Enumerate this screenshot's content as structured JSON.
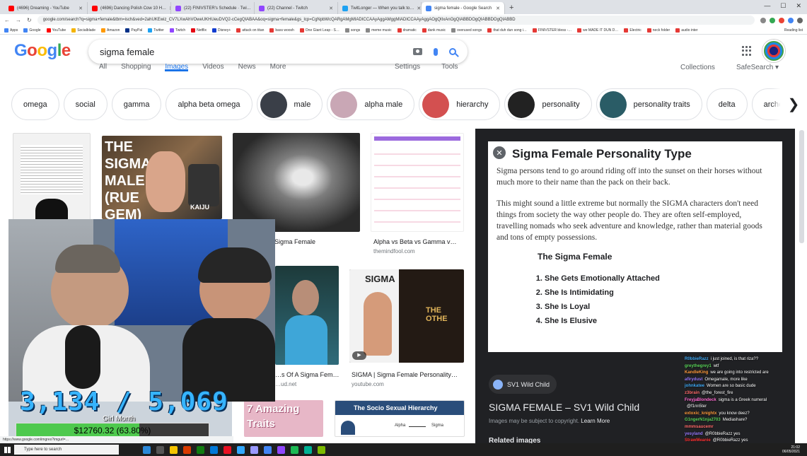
{
  "browser": {
    "tabs": [
      {
        "title": "(4696) Dreaming - YouTube",
        "color": "#ff0000"
      },
      {
        "title": "(4696) Dancing Polish Cow 10 H…",
        "color": "#ff0000"
      },
      {
        "title": "(22) FINIVSTER's Schedule · Twi…",
        "color": "#9146ff"
      },
      {
        "title": "(22) Channel - Twitch",
        "color": "#9146ff"
      },
      {
        "title": "TwitLonger — When you talk to…",
        "color": "#1da1f2"
      },
      {
        "title": "sigma female - Google Search",
        "color": "#4285f4"
      }
    ],
    "url": "google.com/search?q=sigma+female&tbm=isch&ved=2ahUKEwiz_CV7LXwAhVOweUKHUeuDVQ2-cCegQIABAA&oq=sigma+female&gs_lcp=CgNpbWcQARgAMgMIADICCAAyAggAMggMIADICCAAyAggAOgQIIxAnOgQIABBDOgQIABBDOgQIABBD",
    "bookmarks": [
      {
        "label": "Apps",
        "color": "#4285f4"
      },
      {
        "label": "Google",
        "color": "#4285f4"
      },
      {
        "label": "YouTube",
        "color": "#ff0000"
      },
      {
        "label": "Socialblade",
        "color": "#f4b400"
      },
      {
        "label": "Amazon",
        "color": "#ff9900"
      },
      {
        "label": "PayPal",
        "color": "#003087"
      },
      {
        "label": "Twitter",
        "color": "#1da1f2"
      },
      {
        "label": "Twitch",
        "color": "#9146ff"
      },
      {
        "label": "Netflix",
        "color": "#e50914"
      },
      {
        "label": "Disney+",
        "color": "#113ccf"
      },
      {
        "label": "attack on titan",
        "color": "#e53935"
      },
      {
        "label": "bass woosh",
        "color": "#e53935"
      },
      {
        "label": "One Giant Leap - S…",
        "color": "#e53935"
      },
      {
        "label": "songs",
        "color": "#888888"
      },
      {
        "label": "meme music",
        "color": "#888888"
      },
      {
        "label": "dramatic",
        "color": "#e53935"
      },
      {
        "label": "dank music",
        "color": "#e53935"
      },
      {
        "label": "overused songs",
        "color": "#888888"
      },
      {
        "label": "that duh dun song i…",
        "color": "#e53935"
      },
      {
        "label": "FINIVSTER bless -…",
        "color": "#e53935"
      },
      {
        "label": "we MADE IT DUN D…",
        "color": "#e53935"
      },
      {
        "label": "Electric",
        "color": "#e53935"
      },
      {
        "label": "neck folder",
        "color": "#e53935"
      },
      {
        "label": "audio inter",
        "color": "#e53935"
      }
    ],
    "reading_list": "Reading list"
  },
  "google": {
    "logo": [
      "G",
      "o",
      "o",
      "g",
      "l",
      "e"
    ],
    "query": "sigma female",
    "nav": [
      "All",
      "Shopping",
      "Images",
      "Videos",
      "News",
      "More"
    ],
    "nav_active": "Images",
    "nav_right": [
      "Settings",
      "Tools"
    ],
    "collections": "Collections",
    "safesearch": "SafeSearch ▾",
    "chips": [
      {
        "label": "omega",
        "thumb": null
      },
      {
        "label": "social",
        "thumb": null
      },
      {
        "label": "gamma",
        "thumb": null
      },
      {
        "label": "alpha beta omega",
        "thumb": null
      },
      {
        "label": "male",
        "thumb": "#3a3f48"
      },
      {
        "label": "alpha male",
        "thumb": "#c9a7b5"
      },
      {
        "label": "hierarchy",
        "thumb": "#d35050"
      },
      {
        "label": "personality",
        "thumb": "#222222"
      },
      {
        "label": "personality traits",
        "thumb": "#2a5c66"
      },
      {
        "label": "delta",
        "thumb": null
      },
      {
        "label": "archetyp",
        "thumb": null
      }
    ]
  },
  "results": [
    {
      "caption": "Sigma Female",
      "source": ""
    },
    {
      "caption": "Alpha vs Beta vs Gamma v…",
      "source": "themindfool.com"
    },
    {
      "caption": "…s Of A Sigma Fem…",
      "source": "…ud.net"
    },
    {
      "caption": "SIGMA | Sigma Female Personality…",
      "source": "youtube.com"
    }
  ],
  "thumb_text": {
    "sigma_gem": "THE SIGMA MALE (RUE GEM)",
    "kaiju": "KAIJU",
    "sigma_card": "SIGMA",
    "the_other": "THE OTHE",
    "amazing": "7 Amazing Traits",
    "hierarchy": "The Socio Sexual Hierarchy",
    "alpha": "Alpha",
    "sigma_small": "Sigma"
  },
  "preview": {
    "doc_title": "Sigma Female Personality Type",
    "para1": "Sigma persons tend to go around riding off into the sunset on their horses without much more to their name than the pack on their back.",
    "para2": "This might sound a little extreme but normally the SIGMA characters don't need things from society the way other people do. They are often self-employed, travelling nomads who seek adventure and knowledge, rather than material goods and tons of empty possessions.",
    "subheading": "The Sigma Female",
    "list": [
      "She Gets Emotionally Attached",
      "She Is Intimidating",
      "She Is Loyal",
      "She Is Elusive"
    ],
    "source_name": "SV1 Wild Child",
    "title": "SIGMA FEMALE – SV1 Wild Child",
    "copyright": "Images may be subject to copyright.",
    "learn_more": "Learn More",
    "related": "Related images"
  },
  "overlay": {
    "counter": "3,134 / 5,069",
    "girl_month": "Girl Month",
    "money": "$12760.32 (63.80%)",
    "money_pct": 63.8
  },
  "chat": [
    {
      "user": "R0bbieRazz",
      "msg": "i just joined, is that riza??",
      "color": "#3fa9f5"
    },
    {
      "user": "greythegrey1",
      "msg": "wtf",
      "color": "#5cd65c"
    },
    {
      "user": "KandleKing",
      "msg": "we are going into restricted are",
      "color": "#ff9b3d"
    },
    {
      "user": "afirydust",
      "msg": "Omegamale, more like",
      "color": "#9a7cff"
    },
    {
      "user": "johnkatee",
      "msg": "Women are so basic dude",
      "color": "#3fa9f5"
    },
    {
      "user": "z3brain",
      "msg": "@the_forest_fire",
      "color": "#ff6b6b"
    },
    {
      "user": "FreyjaBlondeck",
      "msg": "sigma is a Greek numeral",
      "color": "#ff6bd2"
    },
    {
      "user": "",
      "msg": "@f1nn5ter",
      "color": "#ffffff"
    },
    {
      "user": "extoxic_knightx",
      "msg": "you know deez?",
      "color": "#ff9b3d"
    },
    {
      "user": "G1ngerN1nja2703",
      "msg": "Mediashare?",
      "color": "#5cd65c"
    },
    {
      "user": "mmmsaucemr",
      "msg": "",
      "color": "#ff6b6b"
    },
    {
      "user": "yesyland",
      "msg": "@R0bbieRazz yes",
      "color": "#9a7cff"
    },
    {
      "user": "StrawMeanie",
      "msg": "@R0bbieRazz yes",
      "color": "#ff3333"
    }
  ],
  "statusbar_url": "https://www.google.com/imgres?imgurl=…",
  "taskbar": {
    "search_placeholder": "Type here to search",
    "time": "21:02",
    "date": "06/05/2021",
    "icon_colors": [
      "#2b88d8",
      "#555555",
      "#f5c400",
      "#d83b01",
      "#107c10",
      "#0078d7",
      "#e81123",
      "#31a8ff",
      "#9999ff",
      "#4285f4",
      "#9146ff",
      "#1db954",
      "#00b294",
      "#7cba00"
    ]
  }
}
